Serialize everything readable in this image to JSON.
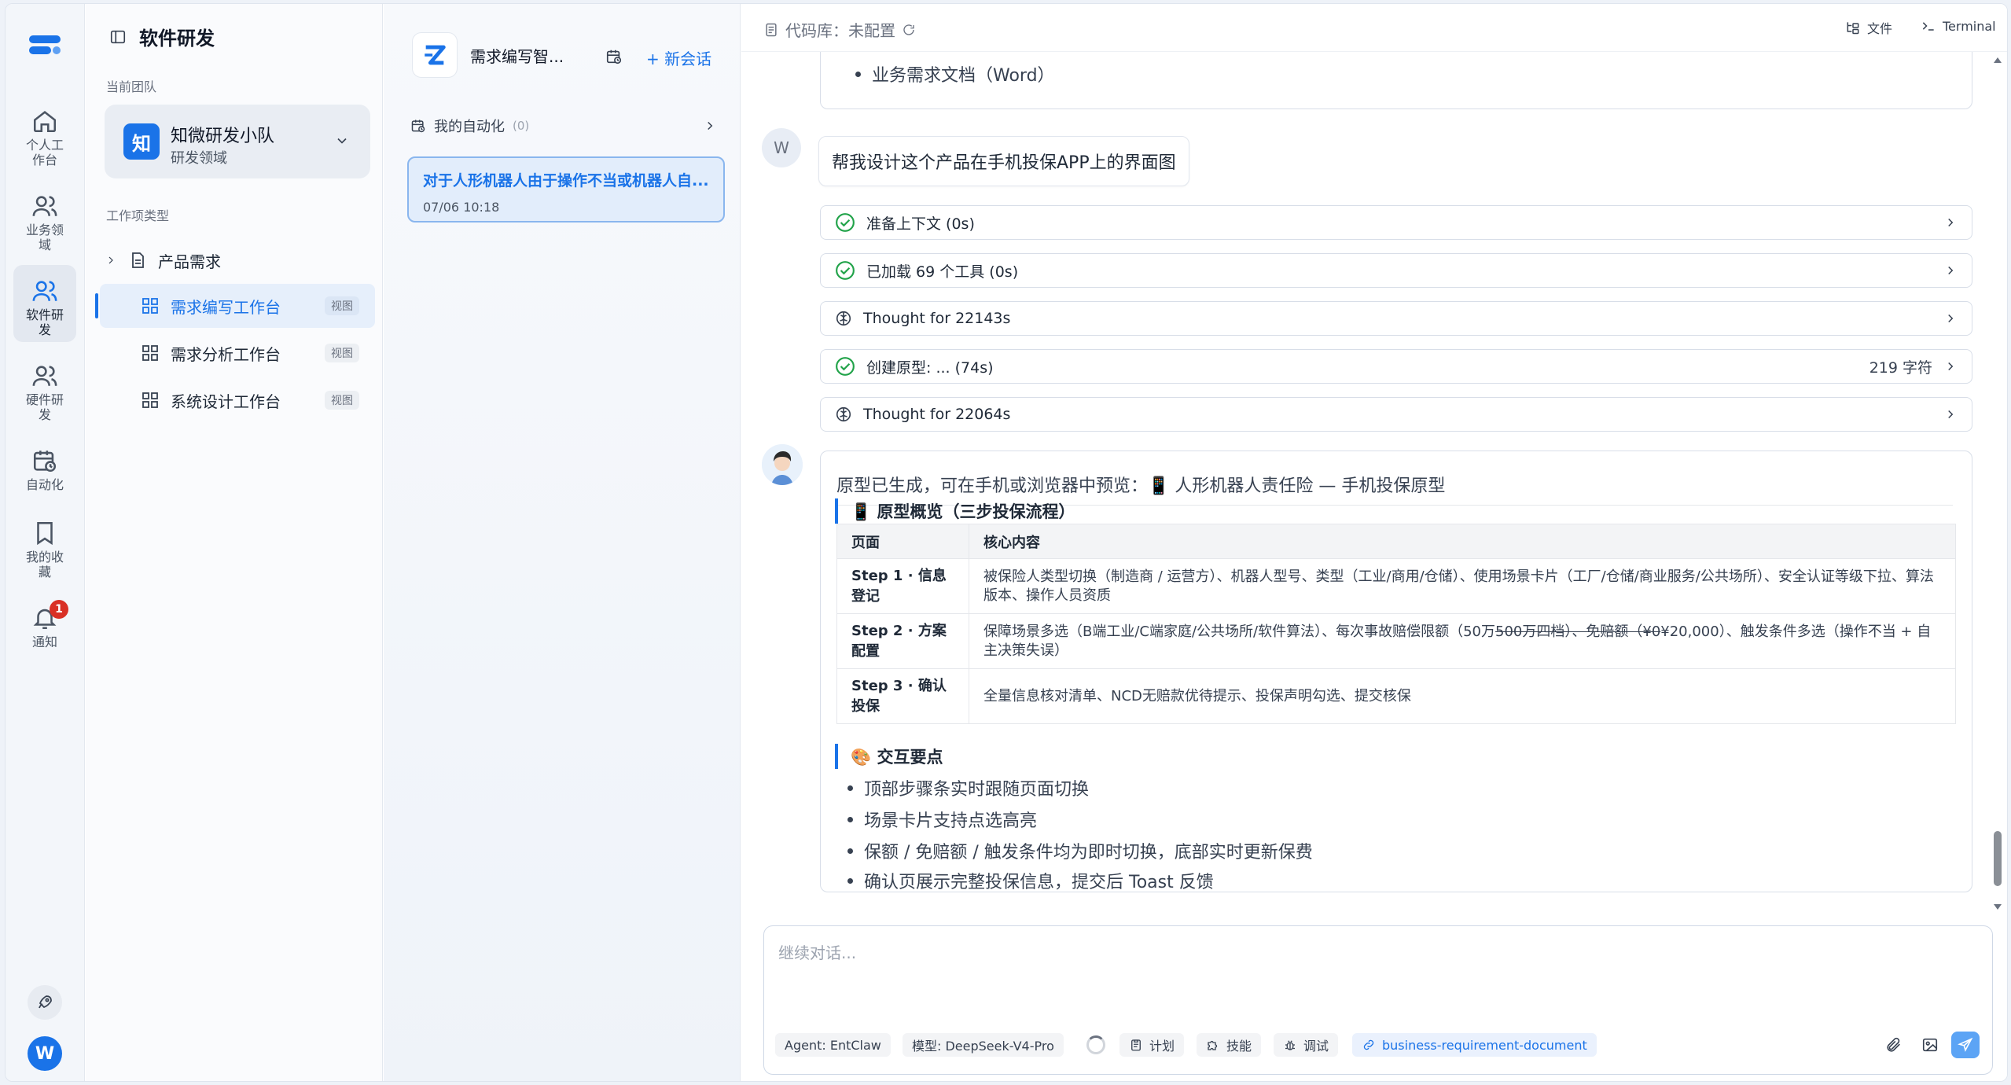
{
  "rail": {
    "items": [
      {
        "label": "个人工作台",
        "icon": "home-icon"
      },
      {
        "label": "业务领域",
        "icon": "users-icon"
      },
      {
        "label": "软件研发",
        "icon": "users-icon",
        "active": true
      },
      {
        "label": "硬件研发",
        "icon": "users-icon"
      },
      {
        "label": "自动化",
        "icon": "calendar-clock-icon"
      },
      {
        "label": "我的收藏",
        "icon": "bookmark-icon"
      },
      {
        "label": "通知",
        "icon": "bell-icon",
        "badge": "1"
      }
    ],
    "user_initial": "W"
  },
  "sidebar": {
    "title": "软件研发",
    "team_caption": "当前团队",
    "team": {
      "logo": "知",
      "name": "知微研发小队",
      "domain": "研发领域"
    },
    "types_caption": "工作项类型",
    "tree": [
      {
        "label": "产品需求"
      },
      {
        "label": "需求编写工作台",
        "tag": "视图",
        "active": true
      },
      {
        "label": "需求分析工作台",
        "tag": "视图"
      },
      {
        "label": "系统设计工作台",
        "tag": "视图"
      }
    ]
  },
  "conversation": {
    "agent_name": "需求编写智...",
    "new_session": "+ 新会话",
    "automation_label": "我的自动化",
    "automation_count": "(0)",
    "session": {
      "title": "对于人形机器人由于操作不当或机器人自...",
      "time": "07/06 10:18"
    }
  },
  "topbar": {
    "repo": "代码库：未配置",
    "files": "文件",
    "terminal": "Terminal"
  },
  "chat": {
    "prev_bullets": [
      "业务需求文档（Word）"
    ],
    "user_initial": "W",
    "user_message": "帮我设计这个产品在手机投保APP上的界面图",
    "steps": [
      {
        "text": "准备上下文 (0s)",
        "icon": "check-circle-icon"
      },
      {
        "text": "已加载 69 个工具 (0s)",
        "icon": "check-circle-icon"
      },
      {
        "text": "Thought for 22143s",
        "icon": "brain-icon"
      },
      {
        "text": "创建原型: ... (74s)",
        "meta": "219 字符",
        "icon": "check-circle-icon"
      },
      {
        "text": "Thought for 22064s",
        "icon": "brain-icon"
      }
    ],
    "answer": {
      "intro": "原型已生成，可在手机或浏览器中预览：📱 人形机器人责任险 — 手机投保原型",
      "overview_heading": "📱 原型概览（三步投保流程）",
      "table_headers": [
        "页面",
        "核心内容"
      ],
      "rows": [
        {
          "step": "Step 1 · 信息登记",
          "content": "被保险人类型切换（制造商 / 运营方）、机器人型号、类型（工业/商用/仓储）、使用场景卡片（工厂/仓储/商业服务/公共场所）、安全认证等级下拉、算法版本、操作人员资质"
        },
        {
          "step": "Step 2 · 方案配置",
          "content_a": "保障场景多选（B端工业/C端家庭/公共场所/软件算法）、每次事故赔偿限额（50万",
          "content_strike": "500万四档）、免赔额（¥0",
          "content_b": "¥20,000）、触发条件多选（操作不当 + 自主决策失误）"
        },
        {
          "step": "Step 3 · 确认投保",
          "content": "全量信息核对清单、NCD无赔款优待提示、投保声明勾选、提交核保"
        }
      ],
      "interaction_heading": "🎨 交互要点",
      "bullets": [
        "顶部步骤条实时跟随页面切换",
        "场景卡片支持点选高亮",
        "保额 / 免赔额 / 触发条件均为即时切换，底部实时更新保费",
        "确认页展示完整投保信息，提交后 Toast 反馈"
      ]
    }
  },
  "composer": {
    "placeholder": "继续对话...",
    "agent": "Agent:  EntClaw",
    "model": "模型:  DeepSeek-V4-Pro",
    "plan": "计划",
    "skill": "技能",
    "debug": "调试",
    "doc_tag": "business-requirement-document"
  }
}
